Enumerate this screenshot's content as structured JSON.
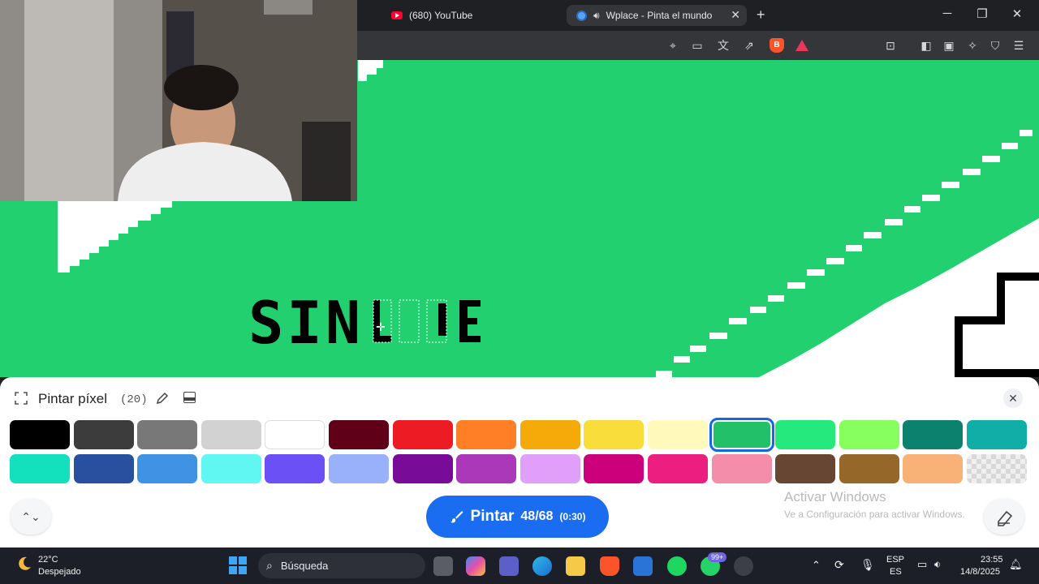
{
  "browser": {
    "tabs": [
      {
        "label": "(680) YouTube",
        "active": false
      },
      {
        "label": "Wplace - Pinta el mundo",
        "active": true
      }
    ]
  },
  "canvas": {
    "text_art": "SIN",
    "colors": {
      "grass": "#22d06f",
      "white": "#ffffff",
      "black": "#000000"
    }
  },
  "panel": {
    "title": "Pintar píxel",
    "count": "(20)",
    "close_label": "✕",
    "palette": [
      "#000000",
      "#3c3c3c",
      "#787878",
      "#d2d2d2",
      "#ffffff",
      "#600018",
      "#ed1c24",
      "#ff7f27",
      "#f6aa09",
      "#f9dd3b",
      "#fffabc",
      "#22c069",
      "#26e97e",
      "#87ff5e",
      "#0c816e",
      "#10aea6",
      "#13e1be",
      "#28509e",
      "#4093e4",
      "#60f7f2",
      "#6b50f6",
      "#99b1fb",
      "#780c99",
      "#aa38b9",
      "#e09ff9",
      "#cb007a",
      "#ec1f80",
      "#f38da9",
      "#684634",
      "#95682a",
      "#f8b277",
      "transparent"
    ],
    "selected_index": 11,
    "paint_button": {
      "label": "Pintar",
      "charges": "48/68",
      "timer": "(0:30)"
    },
    "windows_watermark": {
      "title": "Activar Windows",
      "subtitle": "Ve a Configuración para activar Windows."
    }
  },
  "taskbar": {
    "weather_temp": "22°C",
    "weather_desc": "Despejado",
    "search_placeholder": "Búsqueda",
    "badge": "99+",
    "lang_top": "ESP",
    "lang_bottom": "ES",
    "time": "23:55",
    "date": "14/8/2025"
  }
}
